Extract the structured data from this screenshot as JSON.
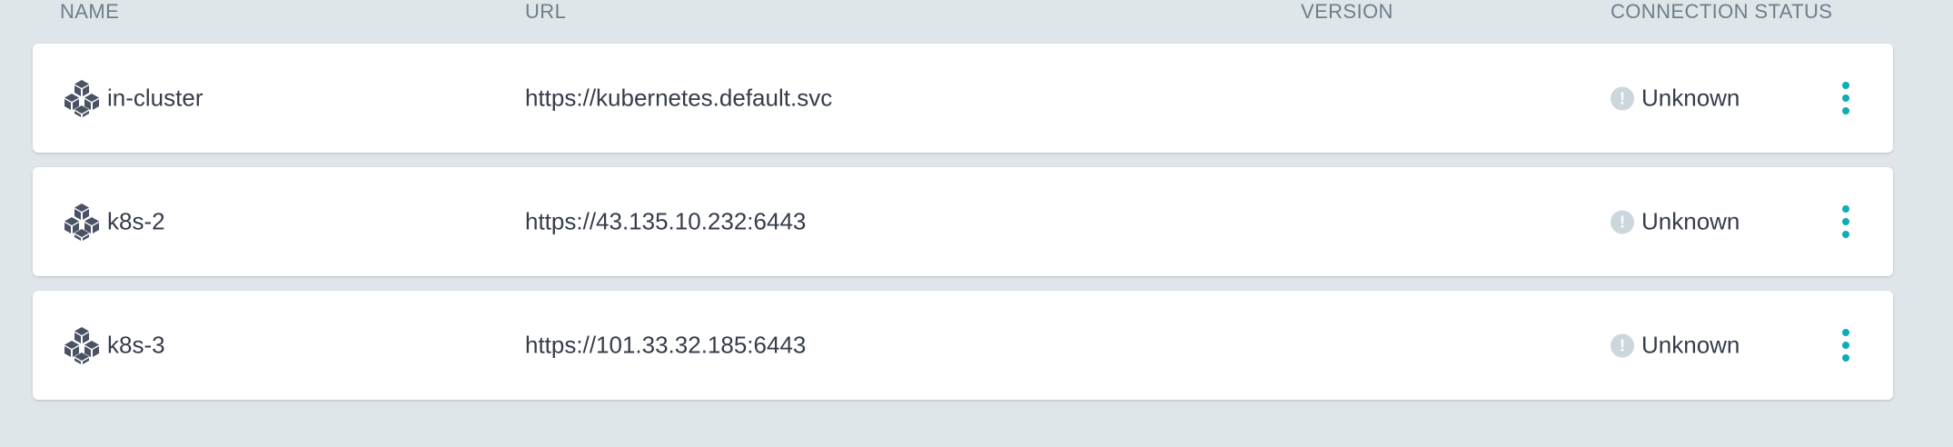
{
  "table": {
    "columns": {
      "name": "NAME",
      "url": "URL",
      "version": "VERSION",
      "status": "CONNECTION STATUS"
    },
    "rows": [
      {
        "name": "in-cluster",
        "url": "https://kubernetes.default.svc",
        "version": "",
        "status": "Unknown"
      },
      {
        "name": "k8s-2",
        "url": "https://43.135.10.232:6443",
        "version": "",
        "status": "Unknown"
      },
      {
        "name": "k8s-3",
        "url": "https://101.33.32.185:6443",
        "version": "",
        "status": "Unknown"
      }
    ]
  },
  "icons": {
    "cluster": "cluster-icon",
    "status": "exclamation-icon",
    "menu": "more-vertical-icon"
  },
  "colors": {
    "page_background": "#dee6ea",
    "menu_accent": "#0dadb8",
    "status_icon": "#ccd6dd",
    "header_text": "#6d7f8b",
    "row_text": "#363c4a"
  }
}
